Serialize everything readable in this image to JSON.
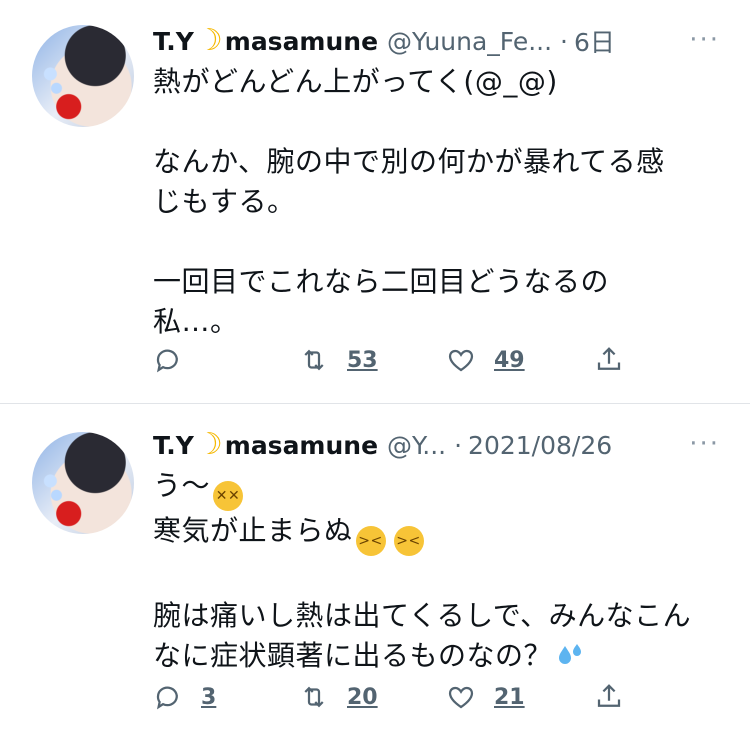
{
  "tweets": [
    {
      "name": "T.Y",
      "name_suffix": "masamune",
      "handle": "@Yuuna_Fe...",
      "separator": "·",
      "time": "6日",
      "more": "···",
      "lines": [
        "熱がどんどん上がってく(@_@)",
        "",
        "なんか、腕の中で別の何かが暴れてる感",
        "じもする。",
        "",
        "一回目でこれなら二回目どうなるの",
        "私…。"
      ],
      "reply_count": "",
      "retweet_count": "53",
      "like_count": "49"
    },
    {
      "name": "T.Y",
      "name_suffix": "masamune",
      "handle": "@Y...",
      "separator": "·",
      "time": "2021/08/26",
      "more": "···",
      "lines": [
        "う〜",
        "寒気が止まらぬ",
        "",
        "腕は痛いし熱は出てくるしで、みんなこん",
        "なに症状顕著に出るものなの？"
      ],
      "emoji": {
        "dizzy": "dizzy-face-emoji",
        "confounded": "confounded-face-emoji",
        "sweat": "sweat-droplets-emoji"
      },
      "reply_count": "3",
      "retweet_count": "20",
      "like_count": "21"
    }
  ],
  "colors": {
    "text": "#0f1419",
    "muted": "#536471",
    "divider": "#e1e4e8",
    "moon": "#f5b800"
  }
}
